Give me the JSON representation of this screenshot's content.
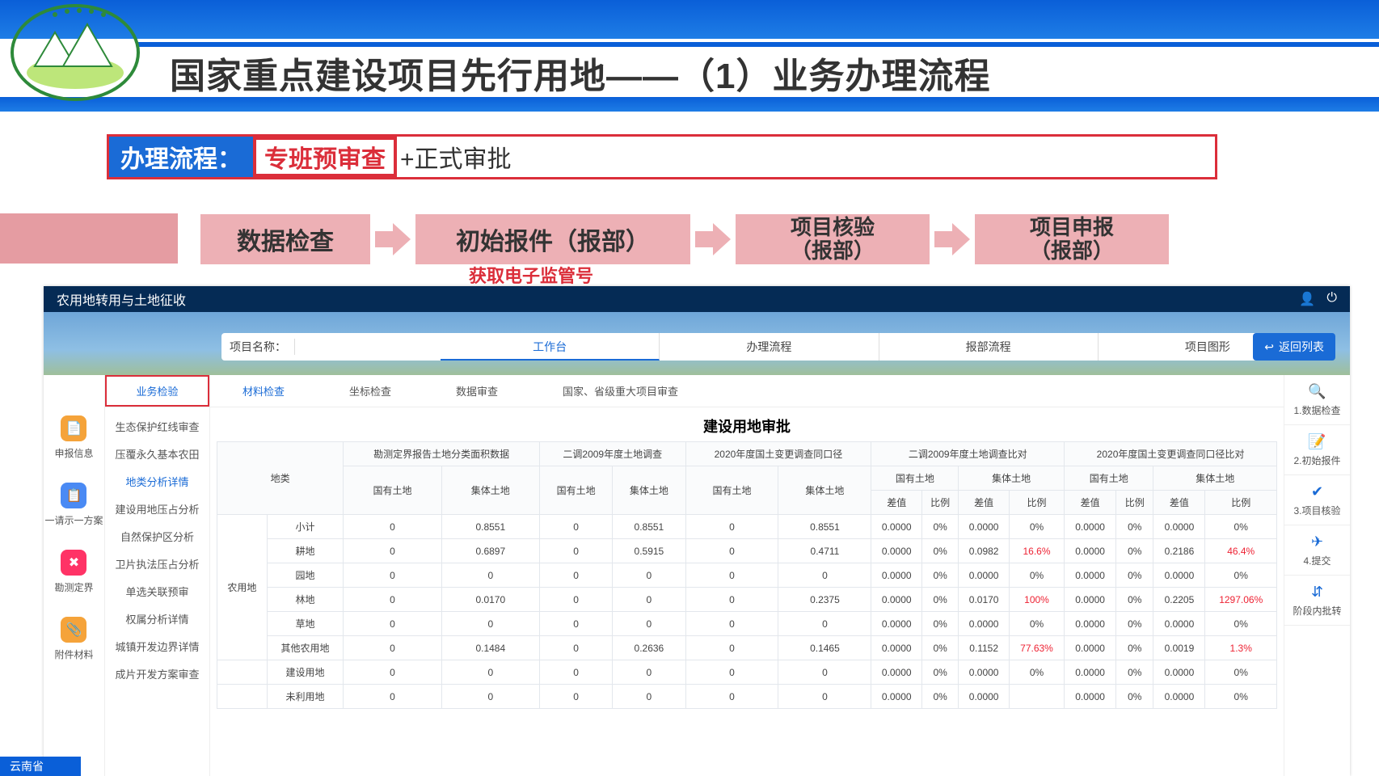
{
  "page_title": "国家重点建设项目先行用地——（1）业务办理流程",
  "flow": {
    "label": "办理流程：",
    "red_box": "专班预审查",
    "rest": "+正式审批"
  },
  "steps": {
    "s1": "数据检查",
    "s2": "初始报件（报部）",
    "s2_note": "获取电子监管号",
    "s3a": "项目核验",
    "s3b": "（报部）",
    "s4a": "项目申报",
    "s4b": "（报部）"
  },
  "app": {
    "header_title": "农用地转用与土地征收",
    "proj_name_label": "项目名称：",
    "nav_tabs": [
      "工作台",
      "办理流程",
      "报部流程",
      "项目图形"
    ],
    "return_btn": "返回列表",
    "rail1": [
      {
        "icon": "📄",
        "color": "#f5a33a",
        "label": "申报信息"
      },
      {
        "icon": "📋",
        "color": "#4a8af4",
        "label": "一请示一方案"
      },
      {
        "icon": "✖",
        "color": "#f36",
        "label": "勘测定界"
      },
      {
        "icon": "📎",
        "color": "#f5a33a",
        "label": "附件材料"
      }
    ],
    "menu_tab": "业务检验",
    "menu_items": [
      "生态保护红线审查",
      "压覆永久基本农田",
      "地类分析详情",
      "建设用地压占分析",
      "自然保护区分析",
      "卫片执法压占分析",
      "单选关联预审",
      "权属分析详情",
      "城镇开发边界详情",
      "成片开发方案审查"
    ],
    "menu_active_index": 2,
    "top_tabs": [
      "材料检查",
      "坐标检查",
      "数据审查",
      "国家、省级重大项目审查"
    ],
    "main_title": "建设用地审批",
    "rail2": [
      {
        "icon": "🔍",
        "label": "1.数据检查"
      },
      {
        "icon": "📝",
        "label": "2.初始报件"
      },
      {
        "icon": "✔",
        "label": "3.项目核验"
      },
      {
        "icon": "✈",
        "label": "4.提交"
      },
      {
        "icon": "⇵",
        "label": "阶段内批转"
      }
    ],
    "table": {
      "group_headers": {
        "c0": "地类",
        "c1": "勘测定界报告土地分类面积数据",
        "c2": "二调2009年度土地调查",
        "c3": "2020年度国土变更调查同口径",
        "c4": "二调2009年度土地调查比对",
        "c5": "2020年度国土变更调查同口径比对"
      },
      "sub_headers": {
        "owned": "国有土地",
        "coll": "集体土地",
        "diff": "差值",
        "ratio": "比例"
      },
      "row_groups": [
        {
          "group": "农用地",
          "rows": [
            "小计",
            "耕地",
            "园地",
            "林地",
            "草地",
            "其他农用地"
          ]
        },
        {
          "group": "",
          "rows": [
            "建设用地"
          ]
        },
        {
          "group": "",
          "rows": [
            "未利用地"
          ]
        }
      ],
      "data": [
        [
          "0",
          "0.8551",
          "0",
          "0.8551",
          "0",
          "0.8551",
          "0.0000",
          "0%",
          "0.0000",
          "0%",
          "0.0000",
          "0%",
          "0.0000",
          "0%"
        ],
        [
          "0",
          "0.6897",
          "0",
          "0.5915",
          "0",
          "0.4711",
          "0.0000",
          "0%",
          "0.0982",
          "16.6%",
          "0.0000",
          "0%",
          "0.2186",
          "46.4%"
        ],
        [
          "0",
          "0",
          "0",
          "0",
          "0",
          "0",
          "0.0000",
          "0%",
          "0.0000",
          "0%",
          "0.0000",
          "0%",
          "0.0000",
          "0%"
        ],
        [
          "0",
          "0.0170",
          "0",
          "0",
          "0",
          "0.2375",
          "0.0000",
          "0%",
          "0.0170",
          "100%",
          "0.0000",
          "0%",
          "0.2205",
          "1297.06%"
        ],
        [
          "0",
          "0",
          "0",
          "0",
          "0",
          "0",
          "0.0000",
          "0%",
          "0.0000",
          "0%",
          "0.0000",
          "0%",
          "0.0000",
          "0%"
        ],
        [
          "0",
          "0.1484",
          "0",
          "0.2636",
          "0",
          "0.1465",
          "0.0000",
          "0%",
          "0.1152",
          "77.63%",
          "0.0000",
          "0%",
          "0.0019",
          "1.3%"
        ],
        [
          "0",
          "0",
          "0",
          "0",
          "0",
          "0",
          "0.0000",
          "0%",
          "0.0000",
          "0%",
          "0.0000",
          "0%",
          "0.0000",
          "0%"
        ],
        [
          "0",
          "0",
          "0",
          "0",
          "0",
          "0",
          "0.0000",
          "0%",
          "0.0000",
          "",
          "0.0000",
          "0%",
          "0.0000",
          "0%"
        ]
      ],
      "red_cells": [
        [
          1,
          9
        ],
        [
          1,
          13
        ],
        [
          3,
          9
        ],
        [
          3,
          13
        ],
        [
          5,
          9
        ],
        [
          5,
          13
        ]
      ]
    }
  },
  "footer": "云南省"
}
